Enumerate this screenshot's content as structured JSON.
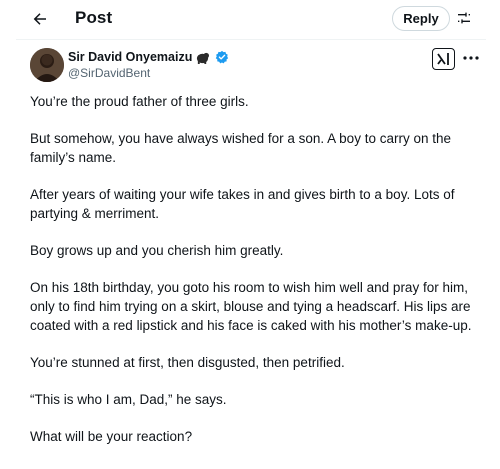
{
  "header": {
    "title": "Post",
    "reply_label": "Reply",
    "back_icon": "arrow-left-icon",
    "settings_icon": "sliders-icon"
  },
  "author": {
    "display_name": "Sir David Onyemaizu",
    "handle": "@SirDavidBent",
    "verified": true,
    "verified_color": "#1d9bf0",
    "name_emoji": "gorilla-emoji"
  },
  "actions": {
    "grok_icon": "grok-icon",
    "more_icon": "more-icon"
  },
  "post": {
    "paragraphs": [
      "You’re the proud father of three girls.",
      "But somehow, you have always wished for a son. A boy to carry on the family’s name.",
      "After years of waiting your wife takes in and gives birth to a boy. Lots of partying & merriment.",
      "Boy grows up and you cherish him greatly.",
      "On his 18th birthday, you goto his room to wish him well and pray for him, only to find him trying on a skirt, blouse and tying a headscarf. His lips are coated with a red lipstick and his face is caked with his mother’s make-up.",
      "You’re stunned at first, then disgusted, then petrified.",
      "“This is who I am, Dad,” he says.",
      "What will be your reaction?"
    ]
  },
  "colors": {
    "text": "#0f1419",
    "secondary": "#536471",
    "border": "#cfd9de"
  }
}
